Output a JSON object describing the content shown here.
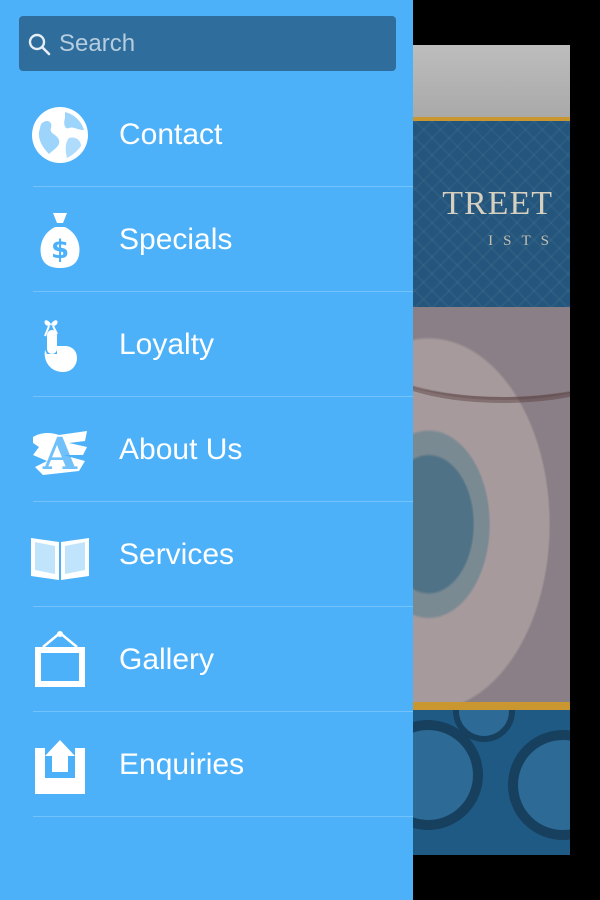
{
  "search": {
    "placeholder": "Search"
  },
  "menu": {
    "items": [
      {
        "label": "Contact",
        "icon": "globe-icon"
      },
      {
        "label": "Specials",
        "icon": "money-bag-icon"
      },
      {
        "label": "Loyalty",
        "icon": "finger-ribbon-icon"
      },
      {
        "label": "About Us",
        "icon": "letter-a-icon"
      },
      {
        "label": "Services",
        "icon": "open-book-icon"
      },
      {
        "label": "Gallery",
        "icon": "picture-frame-icon"
      },
      {
        "label": "Enquiries",
        "icon": "inbox-upload-icon"
      }
    ]
  },
  "background_app": {
    "logo_word": "TREET",
    "logo_sub": "ISTS"
  },
  "colors": {
    "drawer_bg": "#4db1fa",
    "search_bg": "#2f6d9c",
    "accent_gold": "#c9962f"
  }
}
